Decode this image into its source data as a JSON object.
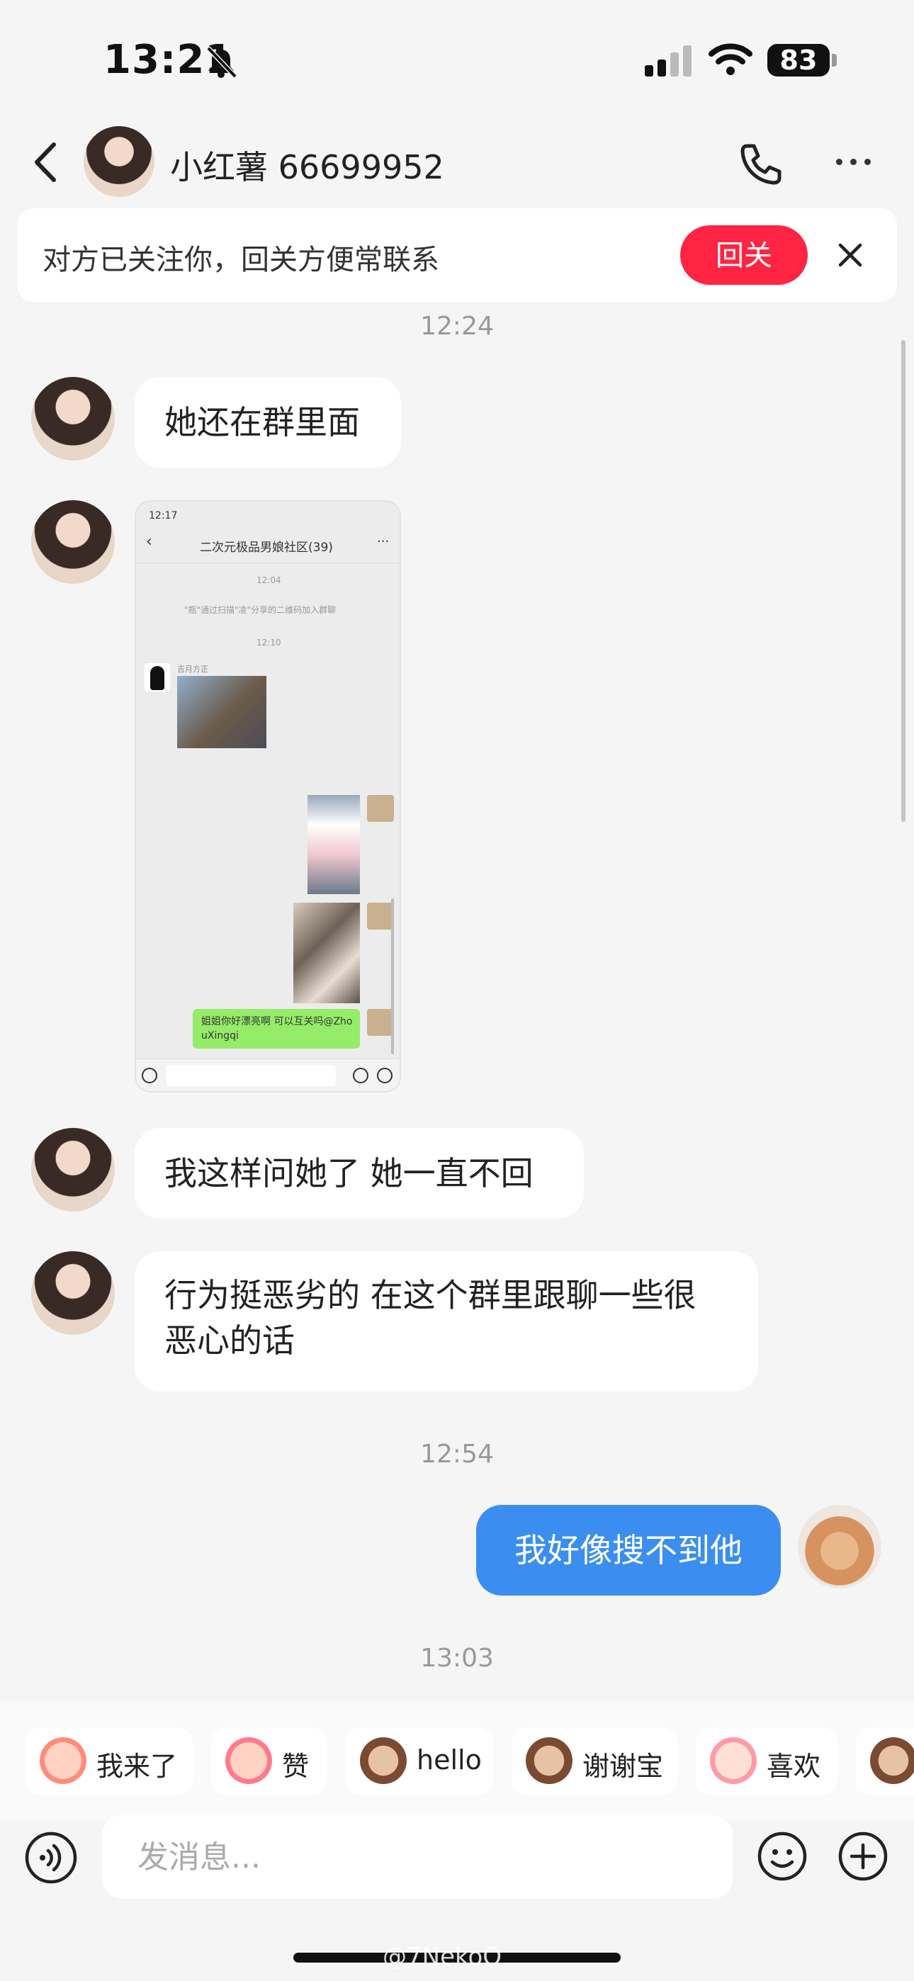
{
  "status_bar": {
    "time": "13:21",
    "battery": "83"
  },
  "header": {
    "title": "小红薯 66699952"
  },
  "follow_banner": {
    "text": "对方已关注你，回关方便常联系",
    "button": "回关"
  },
  "messages": [
    {
      "type": "time",
      "text": "12:24"
    },
    {
      "type": "text",
      "from": "other",
      "text": "她还在群里面"
    },
    {
      "type": "image",
      "from": "other",
      "screenshot": {
        "time": "12:17",
        "title": "二次元极品男娘社区(39)",
        "time_a": "12:04",
        "system_msg": "\"瓶\"通过扫描\"凌\"分享的二维码加入群聊",
        "time_b": "12:10",
        "sender": "吉月方正",
        "last_msg": "姐姐你好漂亮啊 可以互关吗@ZhouXingqi"
      }
    },
    {
      "type": "text",
      "from": "other",
      "text": "我这样问她了 她一直不回"
    },
    {
      "type": "text",
      "from": "other",
      "lines": [
        "行为挺恶劣的 在这个群里跟聊一些很",
        "恶心的话"
      ]
    },
    {
      "type": "time",
      "text": "12:54"
    },
    {
      "type": "text",
      "from": "me",
      "text": "我好像搜不到他"
    },
    {
      "type": "time",
      "text": "13:03"
    }
  ],
  "quick_replies": [
    "我来了",
    "赞",
    "hello",
    "谢谢宝",
    "喜欢"
  ],
  "input": {
    "placeholder": "发消息..."
  },
  "watermark": "@7NekoO",
  "colors": {
    "accent_red": "#ff2442",
    "bubble_blue": "#3b8ef0",
    "background": "#f5f5f5"
  }
}
